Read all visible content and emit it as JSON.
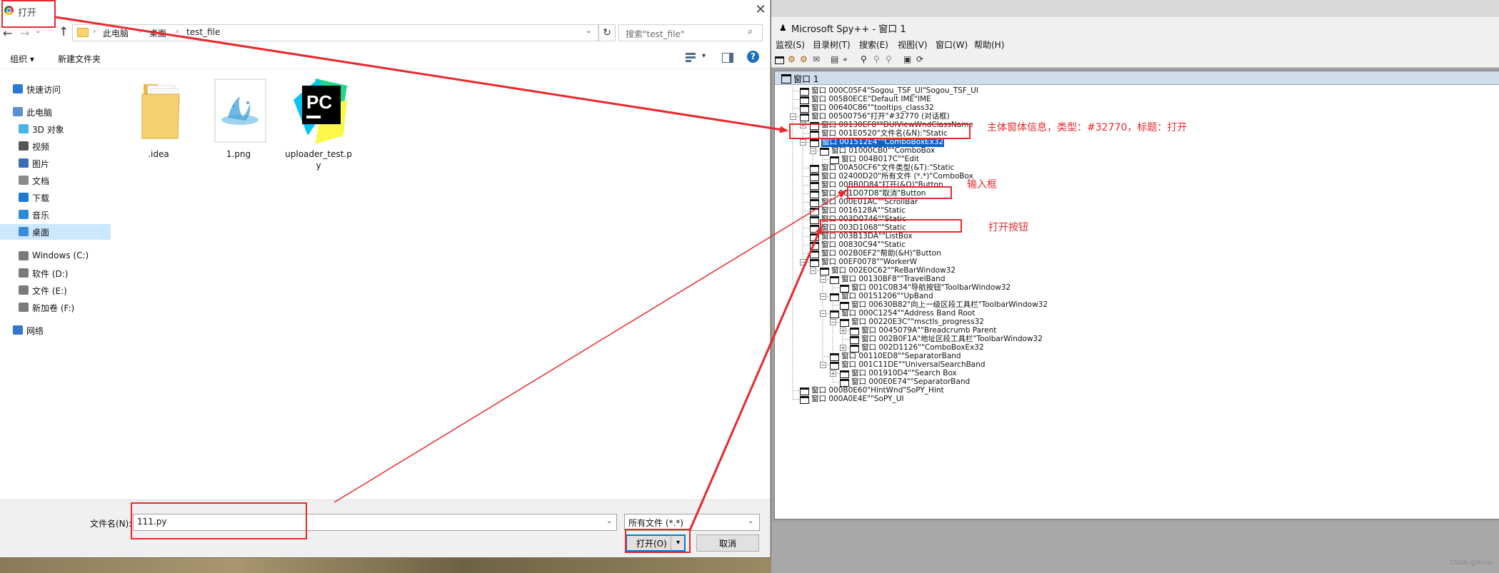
{
  "open_dialog": {
    "title": "打开",
    "close_label": "✕",
    "breadcrumbs": [
      "此电脑",
      "桌面",
      "test_file"
    ],
    "search_placeholder": "搜索\"test_file\"",
    "organize_label": "组织 ▾",
    "new_folder_label": "新建文件夹",
    "nav_items": [
      {
        "label": "快速访问",
        "icon": "star-icon"
      },
      {
        "label": "此电脑",
        "icon": "computer-icon"
      },
      {
        "label": "3D 对象",
        "icon": "cube-icon"
      },
      {
        "label": "视频",
        "icon": "video-icon"
      },
      {
        "label": "图片",
        "icon": "pictures-icon"
      },
      {
        "label": "文档",
        "icon": "documents-icon"
      },
      {
        "label": "下载",
        "icon": "download-icon"
      },
      {
        "label": "音乐",
        "icon": "music-icon"
      },
      {
        "label": "桌面",
        "icon": "desktop-icon",
        "selected": true
      },
      {
        "label": "Windows (C:)",
        "icon": "drive-icon"
      },
      {
        "label": "软件 (D:)",
        "icon": "drive-icon"
      },
      {
        "label": "文件 (E:)",
        "icon": "drive-icon"
      },
      {
        "label": "新加卷 (F:)",
        "icon": "drive-icon"
      },
      {
        "label": "网络",
        "icon": "network-icon"
      }
    ],
    "files": [
      {
        "name": ".idea",
        "kind": "folder"
      },
      {
        "name": "1.png",
        "kind": "image"
      },
      {
        "name": "uploader_test.py",
        "kind": "pycharm"
      }
    ],
    "filename_label": "文件名(N):",
    "filename_value": "111.py",
    "filetype_value": "所有文件 (*.*)",
    "open_label": "打开(O)",
    "cancel_label": "取消"
  },
  "spy": {
    "title": "Microsoft Spy++ - 窗口 1",
    "menu": [
      "监视(S)",
      "目录树(T)",
      "搜索(E)",
      "视图(V)",
      "窗口(W)",
      "帮助(H)"
    ],
    "tree_title": "窗口 1",
    "nodes": [
      {
        "text": "窗口 000C05F4\"Sogou_TSF_UI\"Sogou_TSF_UI",
        "level": 0
      },
      {
        "text": "窗口 005B0ECE\"Default IME\"IME",
        "level": 0
      },
      {
        "text": "窗口 00640C86\"\"tooltips_class32",
        "level": 0
      },
      {
        "text": "窗口 00500756\"打开\"#32770 (对话框)",
        "level": 0,
        "exp": "-"
      },
      {
        "text": "窗口 00130EF8\"\"DUIViewWndClassName",
        "level": 1,
        "exp": "+"
      },
      {
        "text": "窗口 001E0520\"文件名(&N):\"Static",
        "level": 1
      },
      {
        "text": "窗口 001512E4\"\"ComboBoxEx32",
        "level": 1,
        "exp": "-",
        "selected": true
      },
      {
        "text": "窗口 01000CB0\"\"ComboBox",
        "level": 2,
        "exp": "-"
      },
      {
        "text": "窗口 004B017C\"\"Edit",
        "level": 3
      },
      {
        "text": "窗口 00A50CF6\"文件类型(&T):\"Static",
        "level": 1
      },
      {
        "text": "窗口 02400D20\"所有文件 (*.*)\"ComboBox",
        "level": 1
      },
      {
        "text": "窗口 00BB0D84\"打开(&O)\"Button",
        "level": 1
      },
      {
        "text": "窗口 001D07D8\"取消\"Button",
        "level": 1
      },
      {
        "text": "窗口 000E01AC\"\"ScrollBar",
        "level": 1
      },
      {
        "text": "窗口 0016128A\"\"Static",
        "level": 1
      },
      {
        "text": "窗口 003D0746\"\"Static",
        "level": 1
      },
      {
        "text": "窗口 003D1068\"\"Static",
        "level": 1
      },
      {
        "text": "窗口 003B13DA\"\"ListBox",
        "level": 1
      },
      {
        "text": "窗口 00830C94\"\"Static",
        "level": 1
      },
      {
        "text": "窗口 002B0EF2\"帮助(&H)\"Button",
        "level": 1
      },
      {
        "text": "窗口 00EF0078\"\"WorkerW",
        "level": 1,
        "exp": "-"
      },
      {
        "text": "窗口 002E0C62\"\"ReBarWindow32",
        "level": 2,
        "exp": "-"
      },
      {
        "text": "窗口 00130BF8\"\"TravelBand",
        "level": 3,
        "exp": "-"
      },
      {
        "text": "窗口 001C0B34\"导航按钮\"ToolbarWindow32",
        "level": 4
      },
      {
        "text": "窗口 00151206\"\"UpBand",
        "level": 3,
        "exp": "-"
      },
      {
        "text": "窗口 00630B82\"向上一级区段工具栏\"ToolbarWindow32",
        "level": 4
      },
      {
        "text": "窗口 000C1254\"\"Address Band Root",
        "level": 3,
        "exp": "-"
      },
      {
        "text": "窗口 00220E3C\"\"msctls_progress32",
        "level": 4,
        "exp": "-"
      },
      {
        "text": "窗口 0045079A\"\"Breadcrumb Parent",
        "level": 5,
        "exp": "+"
      },
      {
        "text": "窗口 002B0F1A\"地址区段工具栏\"ToolbarWindow32",
        "level": 5
      },
      {
        "text": "窗口 002D1126\"\"ComboBoxEx32",
        "level": 5,
        "exp": "+"
      },
      {
        "text": "窗口 00110ED8\"\"SeparatorBand",
        "level": 3
      },
      {
        "text": "窗口 001C11DE\"\"UniversalSearchBand",
        "level": 3,
        "exp": "-"
      },
      {
        "text": "窗口 001910D4\"\"Search Box",
        "level": 4,
        "exp": "+"
      },
      {
        "text": "窗口 000E0E74\"\"SeparatorBand",
        "level": 4
      },
      {
        "text": "窗口 000B0E60\"HintWnd\"SoPY_Hint",
        "level": 0
      },
      {
        "text": "窗口 000A0E4E\"\"SoPY_UI",
        "level": 0
      }
    ]
  },
  "annotations": {
    "main_window_info": "主体窗体信息，类型：#32770，标题：打开",
    "input_box": "输入框",
    "open_button": "打开按钮"
  },
  "watermark": "CSDN @Rcrzi",
  "colors": {
    "annotation": "#e8282c",
    "selection": "#0a64c8",
    "nav_selected": "#cce8ff"
  }
}
